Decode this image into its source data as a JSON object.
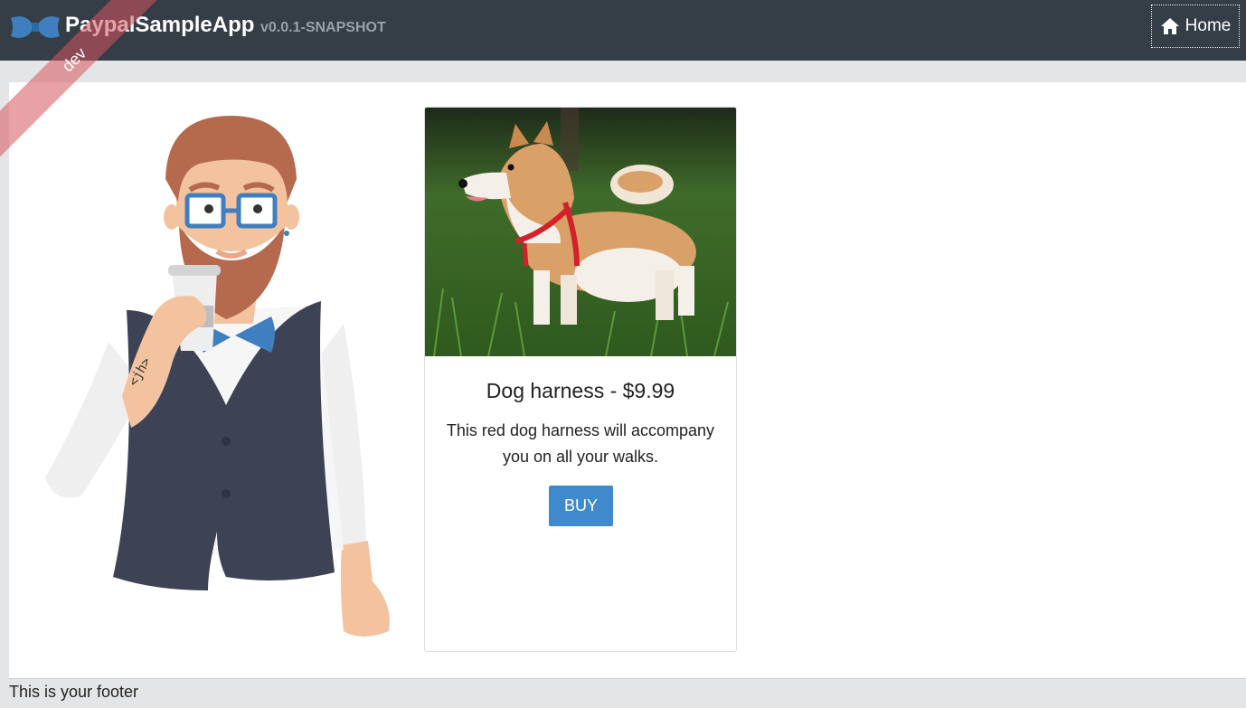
{
  "header": {
    "brand_first": "Paypal",
    "brand_second": "SampleApp",
    "version": "v0.0.1-SNAPSHOT",
    "nav_home_label": "Home",
    "home_icon": "home-icon",
    "logo_icon": "bowtie-logo"
  },
  "ribbon": {
    "label": "dev",
    "color": "#d6555f"
  },
  "product": {
    "image": "shiba-inu-dog-photo",
    "title": "Dog harness - $9.99",
    "description": "This red dog harness will accompany you on all your walks.",
    "buy_label": "BUY"
  },
  "footer": {
    "text": "This is your footer"
  },
  "colors": {
    "navbar": "#353d47",
    "accent": "#3e8acc",
    "page_bg": "#e4e5e6"
  }
}
